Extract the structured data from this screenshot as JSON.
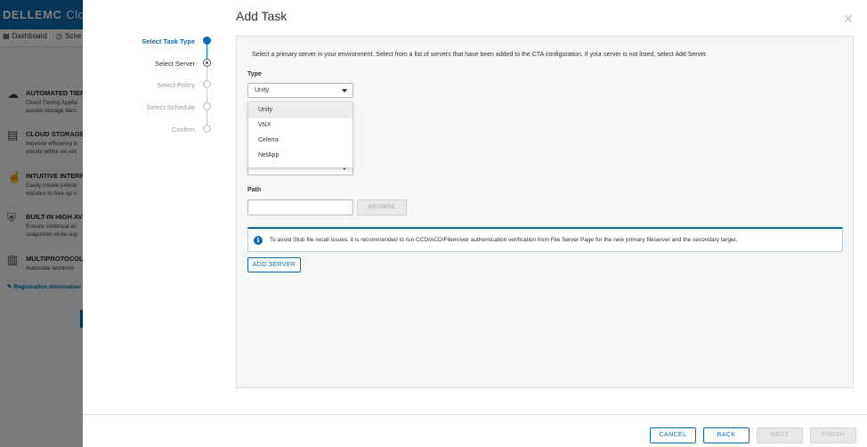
{
  "background": {
    "logo": "DELLEMC",
    "logo_rest": "Clou",
    "nav": [
      {
        "icon": "grid-icon",
        "label": "Dashboard"
      },
      {
        "icon": "clock-icon",
        "label": "Sche"
      }
    ],
    "features": [
      {
        "icon": "cloud-icon",
        "title": "AUTOMATED TIER",
        "lines": [
          "Cloud Tiering Applia",
          "across storage tiers"
        ]
      },
      {
        "icon": "storage-icon",
        "title": "CLOUD STORAGE",
        "lines": [
          "Improve efficiency b",
          "clouds within an ent"
        ]
      },
      {
        "icon": "hand-icon",
        "title": "INTUITIVE INTERF",
        "lines": [
          "Easily create policie",
          "minutes to free up v"
        ]
      },
      {
        "icon": "shield-icon",
        "title": "BUILT-IN HIGH AV",
        "lines": [
          "Ensure continual ac",
          "snapshots while sup"
        ]
      },
      {
        "icon": "server-icon",
        "title": "MULTIPROTOCOL",
        "lines": [
          "Automate technolo"
        ]
      }
    ],
    "registration": "Registration Information"
  },
  "modal": {
    "title": "Add Task",
    "steps": [
      {
        "label": "Select Task Type",
        "state": "active"
      },
      {
        "label": "Select Server",
        "state": "current"
      },
      {
        "label": "Select Policy",
        "state": "pending"
      },
      {
        "label": "Select Schedule",
        "state": "pending"
      },
      {
        "label": "Confirm",
        "state": "pending"
      }
    ],
    "intro": "Select a primary server in your environment. Select from a list of servers that have been added to the CTA configuration. If your server is not listed, select Add Server.",
    "type_label": "Type",
    "type_value": "Unity",
    "type_options": [
      "Unity",
      "VNX",
      "Celerra",
      "NetApp"
    ],
    "path_label": "Path",
    "path_value": "",
    "browse_label": "BROWSE",
    "info_text": "To avoid Stub file recall issues, it is recommended to run CCD/ACD/Filemover authentication verification from File Server Page for the new primary fileserver and the secondary target.",
    "add_server_label": "ADD SERVER",
    "footer": {
      "cancel": "CANCEL",
      "back": "BACK",
      "next": "NEXT",
      "finish": "FINISH"
    }
  },
  "colors": {
    "accent": "#0b6aa8"
  }
}
